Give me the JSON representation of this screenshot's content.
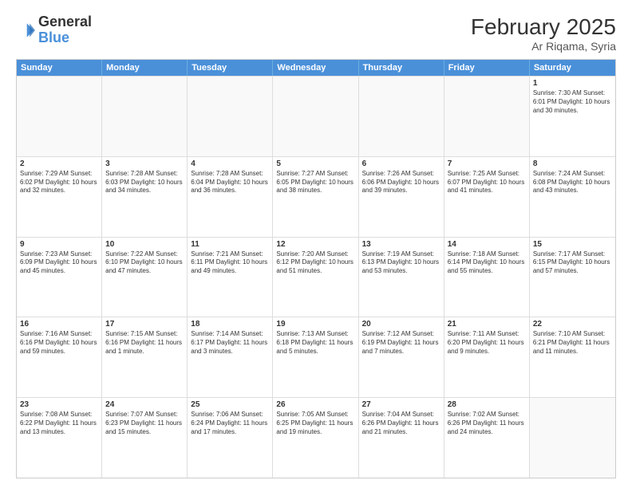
{
  "logo": {
    "general": "General",
    "blue": "Blue"
  },
  "header": {
    "month_year": "February 2025",
    "location": "Ar Riqama, Syria"
  },
  "days": [
    "Sunday",
    "Monday",
    "Tuesday",
    "Wednesday",
    "Thursday",
    "Friday",
    "Saturday"
  ],
  "weeks": [
    [
      {
        "day": "",
        "text": ""
      },
      {
        "day": "",
        "text": ""
      },
      {
        "day": "",
        "text": ""
      },
      {
        "day": "",
        "text": ""
      },
      {
        "day": "",
        "text": ""
      },
      {
        "day": "",
        "text": ""
      },
      {
        "day": "1",
        "text": "Sunrise: 7:30 AM\nSunset: 6:01 PM\nDaylight: 10 hours and 30 minutes."
      }
    ],
    [
      {
        "day": "2",
        "text": "Sunrise: 7:29 AM\nSunset: 6:02 PM\nDaylight: 10 hours and 32 minutes."
      },
      {
        "day": "3",
        "text": "Sunrise: 7:28 AM\nSunset: 6:03 PM\nDaylight: 10 hours and 34 minutes."
      },
      {
        "day": "4",
        "text": "Sunrise: 7:28 AM\nSunset: 6:04 PM\nDaylight: 10 hours and 36 minutes."
      },
      {
        "day": "5",
        "text": "Sunrise: 7:27 AM\nSunset: 6:05 PM\nDaylight: 10 hours and 38 minutes."
      },
      {
        "day": "6",
        "text": "Sunrise: 7:26 AM\nSunset: 6:06 PM\nDaylight: 10 hours and 39 minutes."
      },
      {
        "day": "7",
        "text": "Sunrise: 7:25 AM\nSunset: 6:07 PM\nDaylight: 10 hours and 41 minutes."
      },
      {
        "day": "8",
        "text": "Sunrise: 7:24 AM\nSunset: 6:08 PM\nDaylight: 10 hours and 43 minutes."
      }
    ],
    [
      {
        "day": "9",
        "text": "Sunrise: 7:23 AM\nSunset: 6:09 PM\nDaylight: 10 hours and 45 minutes."
      },
      {
        "day": "10",
        "text": "Sunrise: 7:22 AM\nSunset: 6:10 PM\nDaylight: 10 hours and 47 minutes."
      },
      {
        "day": "11",
        "text": "Sunrise: 7:21 AM\nSunset: 6:11 PM\nDaylight: 10 hours and 49 minutes."
      },
      {
        "day": "12",
        "text": "Sunrise: 7:20 AM\nSunset: 6:12 PM\nDaylight: 10 hours and 51 minutes."
      },
      {
        "day": "13",
        "text": "Sunrise: 7:19 AM\nSunset: 6:13 PM\nDaylight: 10 hours and 53 minutes."
      },
      {
        "day": "14",
        "text": "Sunrise: 7:18 AM\nSunset: 6:14 PM\nDaylight: 10 hours and 55 minutes."
      },
      {
        "day": "15",
        "text": "Sunrise: 7:17 AM\nSunset: 6:15 PM\nDaylight: 10 hours and 57 minutes."
      }
    ],
    [
      {
        "day": "16",
        "text": "Sunrise: 7:16 AM\nSunset: 6:16 PM\nDaylight: 10 hours and 59 minutes."
      },
      {
        "day": "17",
        "text": "Sunrise: 7:15 AM\nSunset: 6:16 PM\nDaylight: 11 hours and 1 minute."
      },
      {
        "day": "18",
        "text": "Sunrise: 7:14 AM\nSunset: 6:17 PM\nDaylight: 11 hours and 3 minutes."
      },
      {
        "day": "19",
        "text": "Sunrise: 7:13 AM\nSunset: 6:18 PM\nDaylight: 11 hours and 5 minutes."
      },
      {
        "day": "20",
        "text": "Sunrise: 7:12 AM\nSunset: 6:19 PM\nDaylight: 11 hours and 7 minutes."
      },
      {
        "day": "21",
        "text": "Sunrise: 7:11 AM\nSunset: 6:20 PM\nDaylight: 11 hours and 9 minutes."
      },
      {
        "day": "22",
        "text": "Sunrise: 7:10 AM\nSunset: 6:21 PM\nDaylight: 11 hours and 11 minutes."
      }
    ],
    [
      {
        "day": "23",
        "text": "Sunrise: 7:08 AM\nSunset: 6:22 PM\nDaylight: 11 hours and 13 minutes."
      },
      {
        "day": "24",
        "text": "Sunrise: 7:07 AM\nSunset: 6:23 PM\nDaylight: 11 hours and 15 minutes."
      },
      {
        "day": "25",
        "text": "Sunrise: 7:06 AM\nSunset: 6:24 PM\nDaylight: 11 hours and 17 minutes."
      },
      {
        "day": "26",
        "text": "Sunrise: 7:05 AM\nSunset: 6:25 PM\nDaylight: 11 hours and 19 minutes."
      },
      {
        "day": "27",
        "text": "Sunrise: 7:04 AM\nSunset: 6:26 PM\nDaylight: 11 hours and 21 minutes."
      },
      {
        "day": "28",
        "text": "Sunrise: 7:02 AM\nSunset: 6:26 PM\nDaylight: 11 hours and 24 minutes."
      },
      {
        "day": "",
        "text": ""
      }
    ]
  ]
}
